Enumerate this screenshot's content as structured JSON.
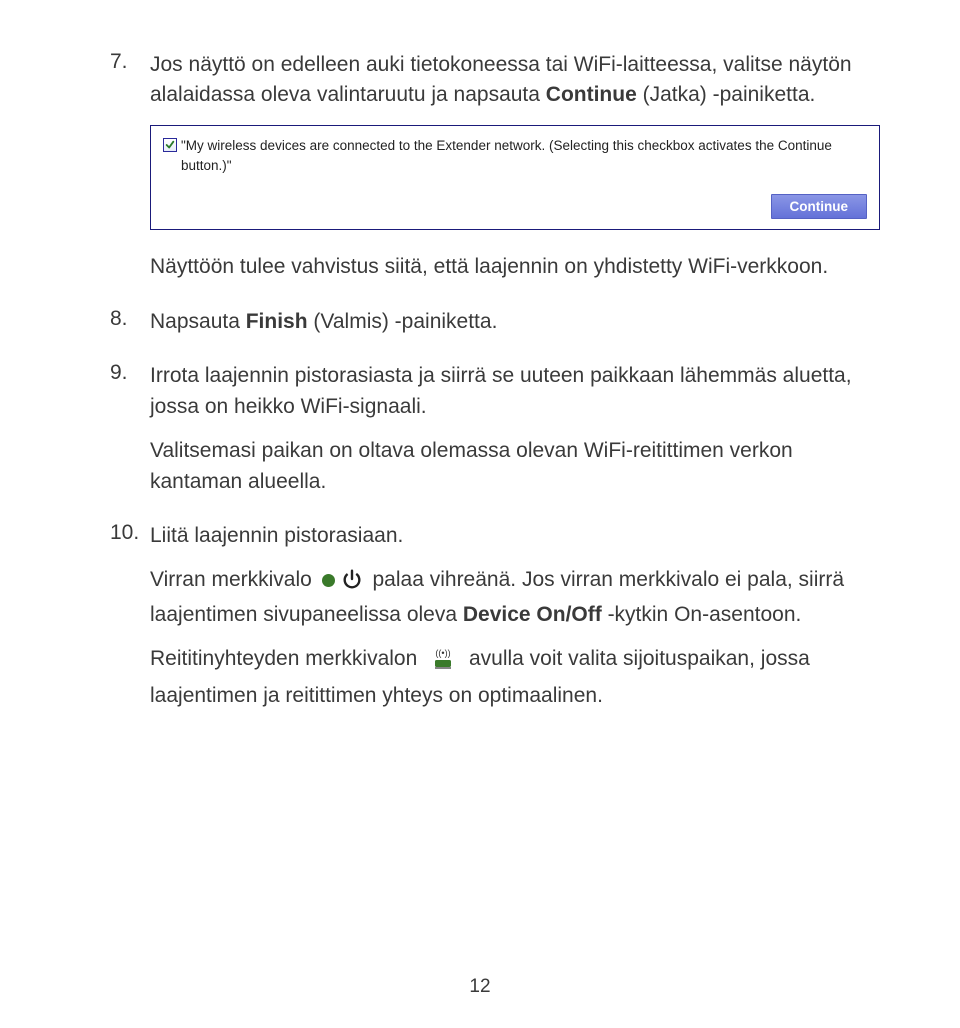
{
  "items": {
    "i7": {
      "num": "7.",
      "para1_a": "Jos näyttö on edelleen auki tietokoneessa tai WiFi-laitteessa, valitse näytön alalaidassa oleva valintaruutu ja napsauta ",
      "bold_continue": "Continue",
      "para1_b": " (Jatka) -painiketta.",
      "screenshot": {
        "checkbox_text": "\"My wireless devices are connected to the Extender network. (Selecting this checkbox activates the Continue button.)\"",
        "continue_label": "Continue"
      },
      "para2": "Näyttöön tulee vahvistus siitä, että laajennin on yhdistetty WiFi-verkkoon."
    },
    "i8": {
      "num": "8.",
      "para_a": "Napsauta ",
      "bold_finish": "Finish",
      "para_b": " (Valmis) -painiketta."
    },
    "i9": {
      "num": "9.",
      "para1": "Irrota laajennin pistorasiasta ja siirrä se uuteen paikkaan lähemmäs aluetta, jossa on heikko WiFi-signaali.",
      "para2": "Valitsemasi paikan on oltava olemassa olevan WiFi-reitittimen verkon kantaman alueella."
    },
    "i10": {
      "num": "10.",
      "para1": "Liitä laajennin pistorasiaan.",
      "para2_a": "Virran merkkivalo ",
      "para2_b": " palaa vihreänä. Jos virran merkkivalo ei pala, siirrä laajentimen sivupaneelissa oleva ",
      "bold_device": "Device On/Off",
      "para2_c": " -kytkin On-asentoon.",
      "para3_a": "Reititinyhteyden merkkivalon ",
      "para3_b": " avulla voit valita sijoituspaikan, jossa laajentimen ja reitittimen yhteys on optimaalinen."
    }
  },
  "page_number": "12"
}
